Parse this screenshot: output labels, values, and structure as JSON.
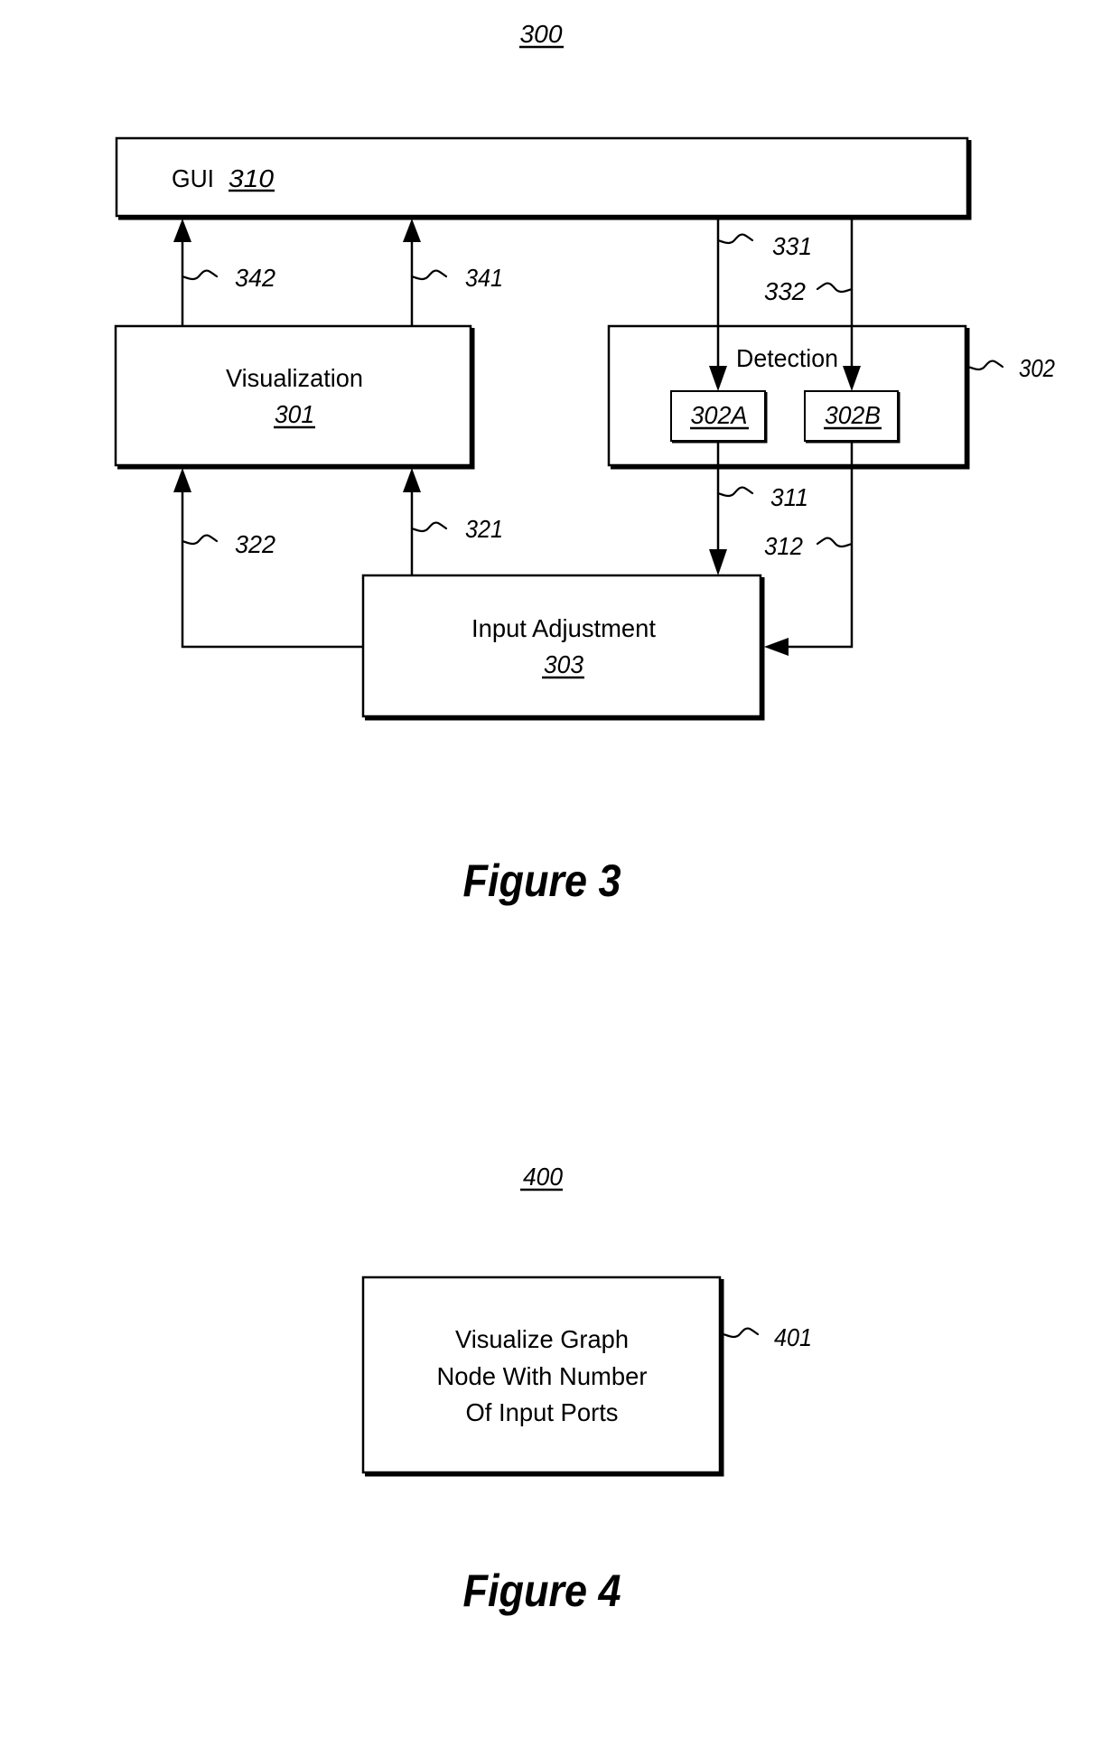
{
  "figure3": {
    "ref_number": "300",
    "caption": "Figure 3",
    "gui": {
      "label": "GUI",
      "ref": "310"
    },
    "visualization": {
      "label": "Visualization",
      "ref": "301"
    },
    "detection": {
      "label": "Detection",
      "ref": "302",
      "subcomponents": [
        {
          "ref": "302A"
        },
        {
          "ref": "302B"
        }
      ]
    },
    "input_adjustment": {
      "label": "Input Adjustment",
      "ref": "303"
    },
    "connections": {
      "c342": "342",
      "c341": "341",
      "c331": "331",
      "c332": "332",
      "c322": "322",
      "c321": "321",
      "c311": "311",
      "c312": "312"
    }
  },
  "figure4": {
    "ref_number": "400",
    "caption": "Figure 4",
    "step": {
      "ref": "401",
      "lines": [
        "Visualize Graph",
        "Node With Number",
        "Of Input Ports"
      ]
    }
  }
}
